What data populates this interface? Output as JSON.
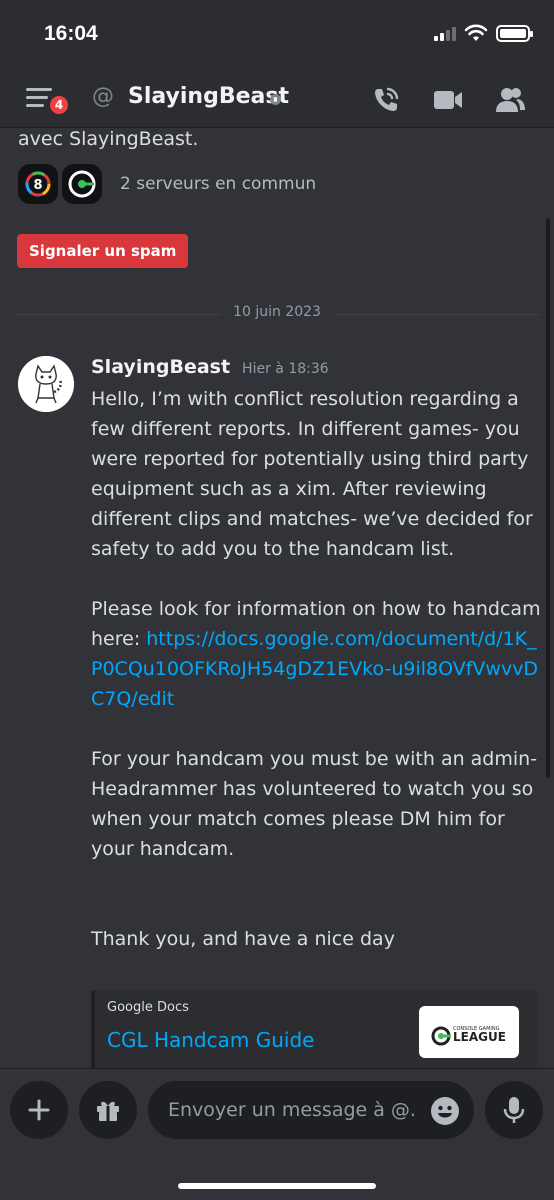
{
  "status_bar": {
    "time": "16:04"
  },
  "header": {
    "badge_count": "4",
    "at_symbol": "@",
    "title": "SlayingBeast"
  },
  "intro": {
    "text": "avec SlayingBeast.",
    "servers_label": "2 serveurs en commun",
    "spam_button": "Signaler un spam"
  },
  "date_divider": "10 juin 2023",
  "message": {
    "author": "SlayingBeast",
    "timestamp": "Hier à 18:36",
    "para1": "Hello, I’m with conflict resolution regarding a few different reports. In different games- you were reported for potentially using third party equipment such as a xim. After reviewing different clips and matches- we’ve decided for safety to add you to the handcam list.",
    "para2_prefix": "Please look for information on how to handcam here: ",
    "para2_link": "https://docs.google.com/document/d/1K_P0CQu10OFKRoJH54gDZ1EVko-u9il8OVfVwvvDC7Q/edit",
    "para3": "For your handcam you must be with an admin- Headrammer has volunteered to watch you so when your match comes please DM him for your handcam.",
    "para4": "Thank you, and have a nice day"
  },
  "embed": {
    "provider": "Google Docs",
    "title": "CGL Handcam Guide",
    "thumb_text_small": "CONSOLE GAMING",
    "thumb_text_big": "LEAGUE"
  },
  "composer": {
    "placeholder": "Envoyer un message à @..."
  },
  "colors": {
    "background": "#313338",
    "header": "#2b2d31",
    "accent_link": "#00a8fc",
    "danger": "#da373c",
    "badge": "#f23f43"
  },
  "icons": [
    "menu-icon",
    "phone-call-icon",
    "video-icon",
    "members-icon",
    "plus-icon",
    "gift-icon",
    "emoji-icon",
    "microphone-icon"
  ]
}
